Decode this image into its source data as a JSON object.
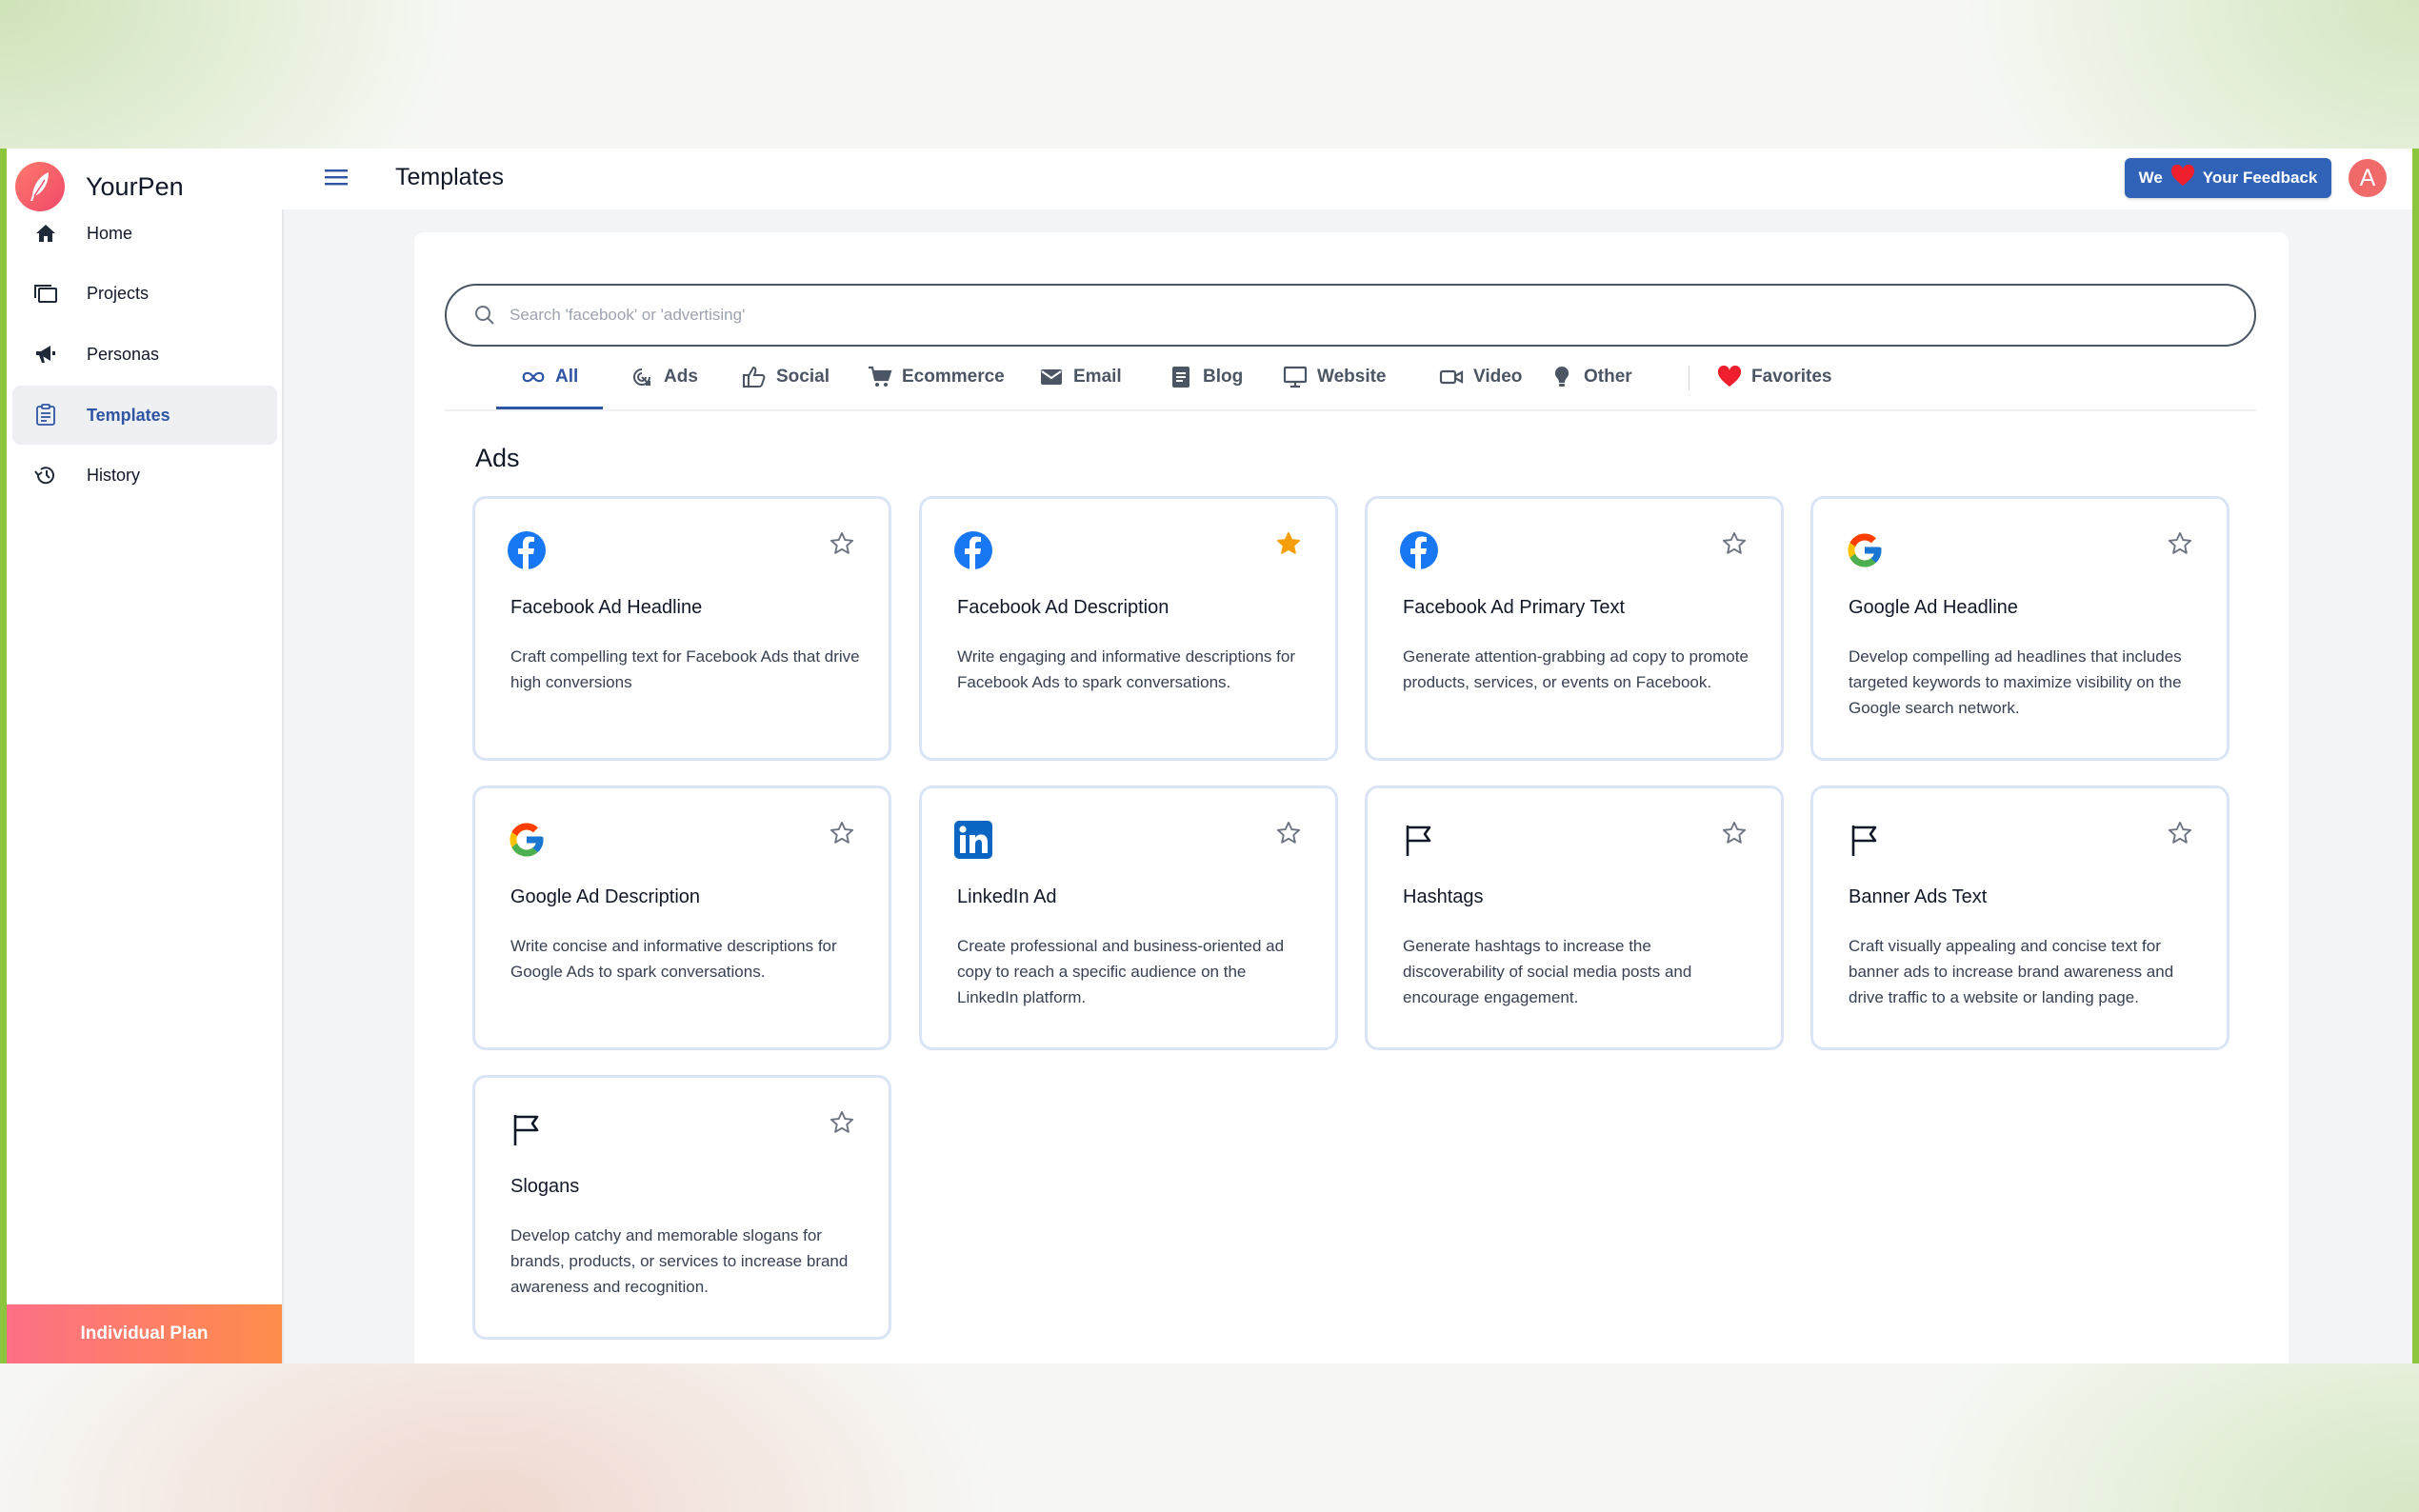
{
  "brand": {
    "name": "YourPen"
  },
  "sidebar": {
    "items": [
      {
        "label": "Home",
        "icon": "home-icon"
      },
      {
        "label": "Projects",
        "icon": "projects-icon"
      },
      {
        "label": "Personas",
        "icon": "megaphone-icon"
      },
      {
        "label": "Templates",
        "icon": "templates-icon",
        "active": true
      },
      {
        "label": "History",
        "icon": "history-icon"
      }
    ],
    "plan_label": "Individual Plan"
  },
  "header": {
    "title": "Templates",
    "feedback_pre": "We",
    "feedback_post": "Your Feedback",
    "avatar_letter": "A"
  },
  "search": {
    "placeholder": "Search 'facebook' or 'advertising'"
  },
  "tabs": [
    {
      "label": "All",
      "icon": "infinity-icon",
      "active": true
    },
    {
      "label": "Ads",
      "icon": "target-icon"
    },
    {
      "label": "Social",
      "icon": "thumbs-up-icon"
    },
    {
      "label": "Ecommerce",
      "icon": "cart-icon"
    },
    {
      "label": "Email",
      "icon": "mail-icon"
    },
    {
      "label": "Blog",
      "icon": "document-icon"
    },
    {
      "label": "Website",
      "icon": "monitor-icon"
    },
    {
      "label": "Video",
      "icon": "video-icon"
    },
    {
      "label": "Other",
      "icon": "lightbulb-icon"
    },
    {
      "label": "Favorites",
      "icon": "heart-icon"
    }
  ],
  "section": {
    "title": "Ads"
  },
  "cards": [
    {
      "title": "Facebook Ad Headline",
      "desc": "Craft compelling text for Facebook Ads that drive high conversions",
      "icon": "facebook-icon",
      "favorite": false
    },
    {
      "title": "Facebook Ad Description",
      "desc": "Write engaging and informative descriptions for Facebook Ads to spark conversations.",
      "icon": "facebook-icon",
      "favorite": true
    },
    {
      "title": "Facebook Ad Primary Text",
      "desc": "Generate attention-grabbing ad copy to promote products, services, or events on Facebook.",
      "icon": "facebook-icon",
      "favorite": false
    },
    {
      "title": "Google Ad Headline",
      "desc": "Develop compelling ad headlines that includes targeted keywords to maximize visibility on the Google search network.",
      "icon": "google-icon",
      "favorite": false
    },
    {
      "title": "Google Ad Description",
      "desc": "Write concise and informative descriptions for Google Ads to spark conversations.",
      "icon": "google-icon",
      "favorite": false
    },
    {
      "title": "LinkedIn Ad",
      "desc": "Create professional and business-oriented ad copy to reach a specific audience on the LinkedIn platform.",
      "icon": "linkedin-icon",
      "favorite": false
    },
    {
      "title": "Hashtags",
      "desc": "Generate hashtags to increase the discoverability of social media posts and encourage engagement.",
      "icon": "flag-icon",
      "favorite": false
    },
    {
      "title": "Banner Ads Text",
      "desc": "Craft visually appealing and concise text for banner ads to increase brand awareness and drive traffic to a website or landing page.",
      "icon": "flag-icon",
      "favorite": false
    },
    {
      "title": "Slogans",
      "desc": "Develop catchy and memorable slogans for brands, products, or services to increase brand awareness and recognition.",
      "icon": "flag-icon",
      "favorite": false
    }
  ],
  "colors": {
    "accent": "#2f55a4",
    "feedback_button": "#3063b8",
    "star_active": "#f59e0b",
    "facebook": "#1877f2",
    "linkedin": "#0a66c2",
    "plan_gradient_start": "#fd6f86",
    "plan_gradient_end": "#fe8d4a"
  }
}
